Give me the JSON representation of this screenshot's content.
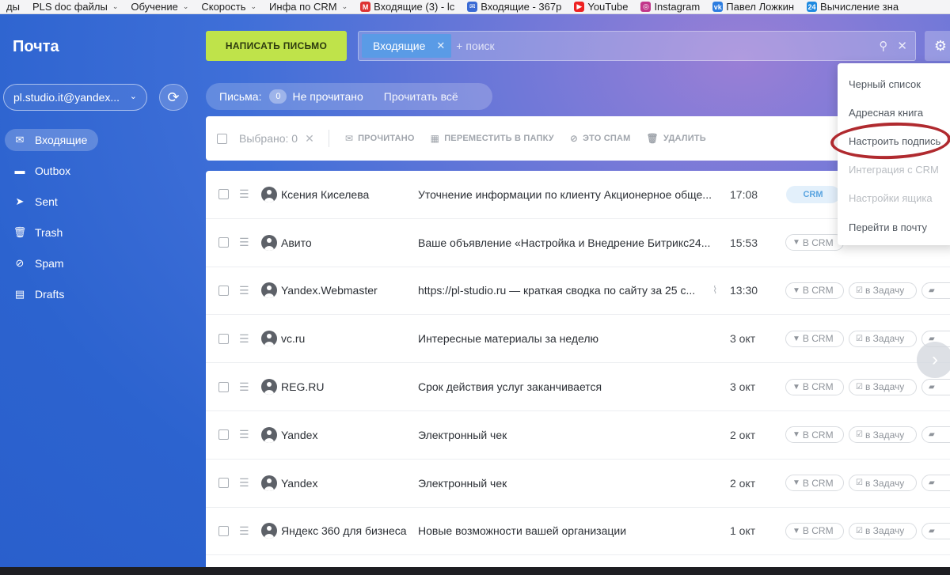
{
  "bookmarks": [
    {
      "label": "ды",
      "chevron": false,
      "icon": ""
    },
    {
      "label": "PLS doc файлы",
      "chevron": true,
      "icon": ""
    },
    {
      "label": "Обучение",
      "chevron": true,
      "icon": ""
    },
    {
      "label": "Скорость",
      "chevron": true,
      "icon": ""
    },
    {
      "label": "Инфа по CRM",
      "chevron": true,
      "icon": ""
    },
    {
      "label": "Входящие (3) - lc",
      "chevron": false,
      "icon": "M"
    },
    {
      "label": "Входящие - 367р",
      "chevron": false,
      "icon": "✉"
    },
    {
      "label": "YouTube",
      "chevron": false,
      "icon": "▶"
    },
    {
      "label": "Instagram",
      "chevron": false,
      "icon": "◎"
    },
    {
      "label": "Павел Ложкин",
      "chevron": false,
      "icon": "vk"
    },
    {
      "label": "Вычисление зна",
      "chevron": false,
      "icon": "24"
    }
  ],
  "app": {
    "title": "Почта",
    "compose_label": "НАПИСАТЬ ПИСЬМО",
    "search": {
      "chip": "Входящие",
      "placeholder": "+ поиск"
    },
    "account": "pl.studio.it@yandex...",
    "nav": [
      {
        "label": "Входящие",
        "icon": "inbox-icon",
        "active": true
      },
      {
        "label": "Outbox",
        "icon": "folder-icon",
        "active": false
      },
      {
        "label": "Sent",
        "icon": "sent-icon",
        "active": false
      },
      {
        "label": "Trash",
        "icon": "trash-icon",
        "active": false
      },
      {
        "label": "Spam",
        "icon": "spam-icon",
        "active": false
      },
      {
        "label": "Drafts",
        "icon": "drafts-icon",
        "active": false
      }
    ],
    "filter": {
      "label": "Письма:",
      "count": "0",
      "unread": "Не прочитано",
      "read_all": "Прочитать всё"
    },
    "toolbar": {
      "selected": "Выбрано: 0",
      "actions": [
        {
          "label": "ПРОЧИТАНО",
          "icon": "read-icon"
        },
        {
          "label": "ПЕРЕМЕСТИТЬ В ПАПКУ",
          "icon": "move-folder-icon"
        },
        {
          "label": "ЭТО СПАМ",
          "icon": "spam-icon"
        },
        {
          "label": "УДАЛИТЬ",
          "icon": "trash-icon"
        }
      ]
    },
    "messages": [
      {
        "from": "Ксения Киселева",
        "subject": "Уточнение информации по клиенту Акционерное обще...",
        "time": "17:08",
        "crm_tag": "CRM",
        "attachment": false
      },
      {
        "from": "Авито",
        "subject": "Ваше объявление «Настройка и Внедрение Битрикс24...",
        "time": "15:53",
        "crm_tag": "",
        "attachment": false
      },
      {
        "from": "Yandex.Webmaster",
        "subject": "https://pl-studio.ru — краткая сводка по сайту за 25 с...",
        "time": "13:30",
        "crm_tag": "",
        "attachment": true
      },
      {
        "from": "vc.ru",
        "subject": "Интересные материалы за неделю",
        "time": "3 окт",
        "crm_tag": "",
        "attachment": false
      },
      {
        "from": "REG.RU",
        "subject": "Срок действия услуг заканчивается",
        "time": "3 окт",
        "crm_tag": "",
        "attachment": false
      },
      {
        "from": "Yandex",
        "subject": "Электронный чек",
        "time": "2 окт",
        "crm_tag": "",
        "attachment": false
      },
      {
        "from": "Yandex",
        "subject": "Электронный чек",
        "time": "2 окт",
        "crm_tag": "",
        "attachment": false
      },
      {
        "from": "Яндекс 360 для бизнеса",
        "subject": "Новые возможности вашей организации",
        "time": "1 окт",
        "crm_tag": "",
        "attachment": false
      }
    ],
    "row_actions": {
      "to_crm": "В CRM",
      "to_task": "в Задачу"
    },
    "settings_menu": [
      {
        "label": "Черный список",
        "disabled": false
      },
      {
        "label": "Адресная книга",
        "disabled": false
      },
      {
        "label": "Настроить подпись",
        "disabled": false
      },
      {
        "label": "Интеграция с CRM",
        "disabled": true
      },
      {
        "label": "Настройки ящика",
        "disabled": true
      },
      {
        "label": "Перейти в почту",
        "disabled": false
      }
    ]
  },
  "colors": {
    "accent_compose": "#bfe34a",
    "highlight": "#b02a2f",
    "crm_tag": "#59a4e0"
  }
}
